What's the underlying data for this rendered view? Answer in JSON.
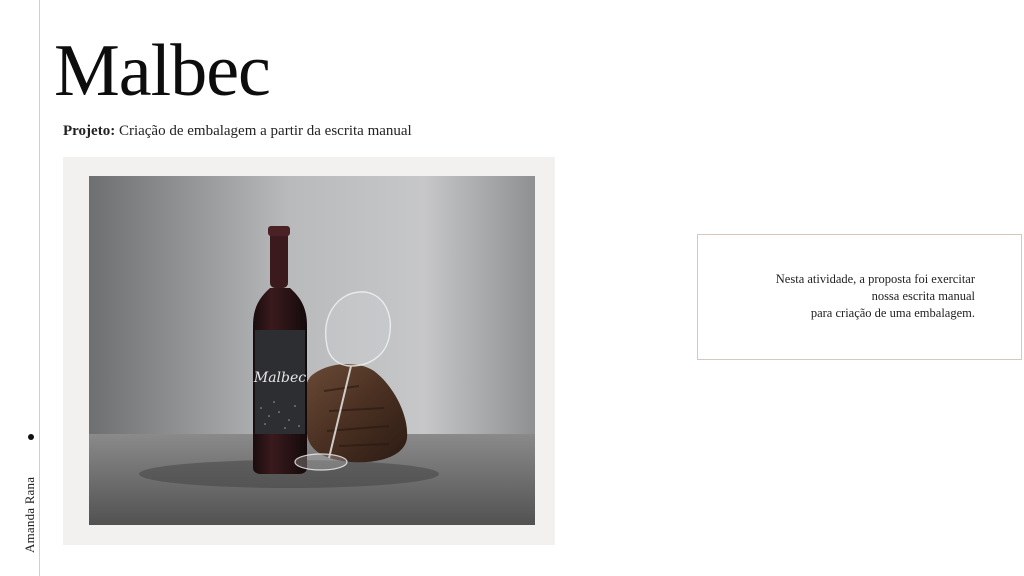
{
  "page": {
    "title": "Malbec",
    "subtitle": {
      "label": "Projeto:",
      "text": " Criação de embalagem a partir da escrita manual"
    },
    "author": "Amanda Rana"
  },
  "photo": {
    "bottle_label_text": "Malbec"
  },
  "note": {
    "lines": [
      "Nesta atividade, a proposta foi exercitar",
      "nossa escrita manual",
      "para criação de uma embalagem."
    ]
  },
  "colors": {
    "background": "#ffffff",
    "frame": "#f2f1ef",
    "note_border": "#d9c7bd",
    "text": "#111111"
  }
}
